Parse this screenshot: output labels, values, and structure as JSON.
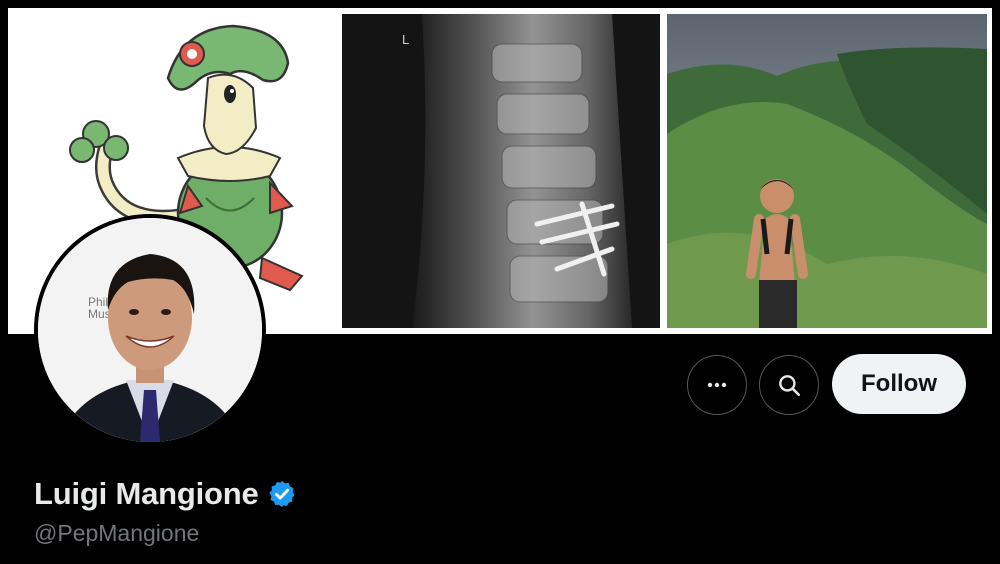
{
  "profile": {
    "display_name": "Luigi Mangione",
    "handle": "@PepMangione",
    "verified": true,
    "verified_color": "#1d9bf0"
  },
  "actions": {
    "more_icon": "more-horizontal-icon",
    "search_icon": "search-icon",
    "follow_label": "Follow"
  },
  "banner": {
    "tiles": [
      {
        "depicts": "green pokemon illustration"
      },
      {
        "depicts": "spine x-ray with surgical screws"
      },
      {
        "depicts": "man hiking on green mountain ridge"
      }
    ]
  },
  "avatar": {
    "backdrop_text_line1": "Philad",
    "backdrop_text_line2": "Museu"
  },
  "xray": {
    "marker": "L"
  }
}
